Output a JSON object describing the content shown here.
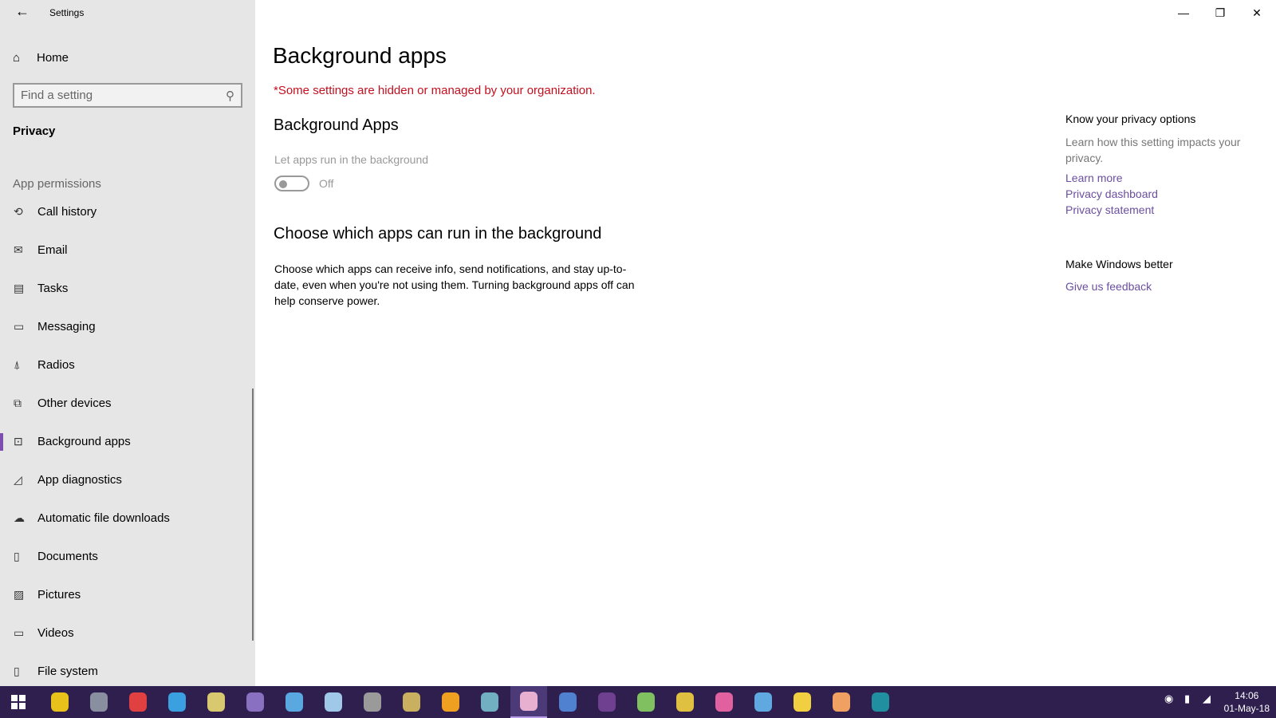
{
  "window": {
    "title": "Settings",
    "minimize": "—",
    "restore": "❐",
    "close": "✕"
  },
  "sidebar": {
    "back": "←",
    "home": "Home",
    "search_placeholder": "Find a setting",
    "section": "Privacy",
    "group": "App permissions",
    "items": [
      {
        "label": "Call history",
        "icon": "⟲"
      },
      {
        "label": "Email",
        "icon": "✉"
      },
      {
        "label": "Tasks",
        "icon": "▤"
      },
      {
        "label": "Messaging",
        "icon": "▭"
      },
      {
        "label": "Radios",
        "icon": "⍋"
      },
      {
        "label": "Other devices",
        "icon": "⧉"
      },
      {
        "label": "Background apps",
        "icon": "⊡",
        "active": true
      },
      {
        "label": "App diagnostics",
        "icon": "◿"
      },
      {
        "label": "Automatic file downloads",
        "icon": "☁"
      },
      {
        "label": "Documents",
        "icon": "▯"
      },
      {
        "label": "Pictures",
        "icon": "▨"
      },
      {
        "label": "Videos",
        "icon": "▭"
      },
      {
        "label": "File system",
        "icon": "▯"
      }
    ]
  },
  "main": {
    "title": "Background apps",
    "notice": "*Some settings are hidden or managed by your organization.",
    "section1": "Background Apps",
    "toggle_label": "Let apps run in the background",
    "toggle_state": "Off",
    "section2": "Choose which apps can run in the background",
    "description": "Choose which apps can receive info, send notifications, and stay up-to-date, even when you're not using them. Turning background apps off can help conserve power."
  },
  "aside": {
    "privacy_heading": "Know your privacy options",
    "privacy_text": "Learn how this setting impacts your privacy.",
    "links": [
      "Learn more",
      "Privacy dashboard",
      "Privacy statement"
    ],
    "better_heading": "Make Windows better",
    "feedback": "Give us feedback"
  },
  "taskbar": {
    "time": "14:06",
    "date": "01-May-18",
    "app_colors": [
      "#e8c21a",
      "#8a8fa0",
      "#e04040",
      "#3ba0e0",
      "#d8c870",
      "#8a70c0",
      "#5aa8e0",
      "#a0c8e8",
      "#9a9a9a",
      "#c8b060",
      "#f0a020",
      "#70b0c0",
      "#e8b0d0",
      "#5080d0",
      "#704090",
      "#80c060",
      "#e0c040",
      "#e060a0",
      "#60a8e0",
      "#f0d040",
      "#f0a060",
      "#2090a0"
    ]
  },
  "colors": {
    "accent": "#7e4fb0",
    "link": "#6b4fa0",
    "warning": "#c50f1f",
    "taskbar": "#2e1f4e"
  }
}
